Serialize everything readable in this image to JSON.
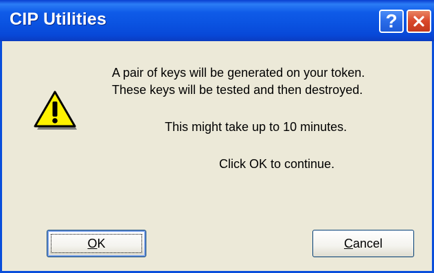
{
  "window": {
    "title": "CIP Utilities",
    "help_glyph": "?",
    "close_icon": "close-icon"
  },
  "message": {
    "line1": "A pair of keys will be generated on your token.",
    "line2": "These keys will be tested and then destroyed.",
    "line3": "This might take up to 10 minutes.",
    "line4": "Click OK to continue."
  },
  "buttons": {
    "ok_mnemonic": "O",
    "ok_rest": "K",
    "cancel_mnemonic": "C",
    "cancel_rest": "ancel"
  },
  "colors": {
    "titlebar": "#0A52E0",
    "dialog_bg": "#ECE9D8",
    "close": "#D9472A",
    "warning": "#FFF200"
  },
  "icons": {
    "dialog_icon": "warning-icon"
  }
}
